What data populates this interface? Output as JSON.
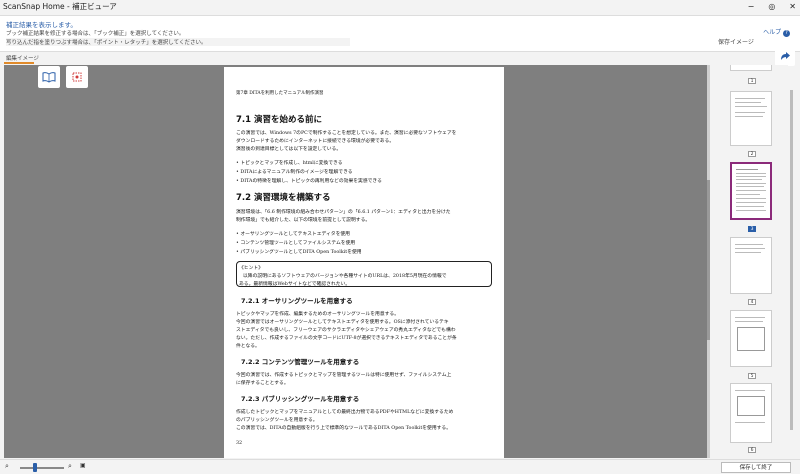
{
  "window": {
    "title": "ScanSnap Home - 補正ビューア",
    "controls": [
      "−",
      "◎",
      "✕"
    ]
  },
  "info": {
    "message": "補正結果を表示します。",
    "line1": "ブック補正結果を修正する場合は、「ブック補正」を選択してください。",
    "line2": "写り込んだ指を塗りつぶす場合は、「ポイント・レタッチ」を選択してください。",
    "help": "ヘルプ"
  },
  "sidebar": {
    "label": "保存イメージ"
  },
  "editor": {
    "label": "編集イメージ"
  },
  "page": {
    "header": "第7章 DITAを利用したマニュアル制作演習",
    "s71_title": "7.1 演習を始める前に",
    "s71_p1": "この演習では、Windows 7のPCで制作することを想定している。また、演習に必要なソフトウェアを",
    "s71_p2": "ダウンロードするためにインターネットに接続できる環境が必要である。",
    "s71_p3": "演習後の到達目標としては以下を設定している。",
    "b1": "トピックとマップを作成し、htmlに変換できる",
    "b2": "DITAによるマニュアル制作のイメージを理解できる",
    "b3": "DITAの特徴を理解し、トピックの再利用などの効果を実感できる",
    "s72_title": "7.2 演習環境を構築する",
    "s72_p1": "演習環境は、「6.6 制作環境の組み合わせパターン」の「6.6.1 パターン1：エディタと出力を分けた",
    "s72_p2": "制作環境」でも紹介した、以下の環境を前提として説明する。",
    "b4": "オーサリングツールとしてテキストエディタを使用",
    "b5": "コンテンツ管理ツールとしてファイルシステムを使用",
    "b6": "パブリッシングツールとしてDITA Open Toolkitを使用",
    "hint_title": "《ヒント》",
    "hint_p1": "以降の説明にあるソフトウェアのバージョンや各種サイトのURLは、2018年5月現在の情報で",
    "hint_p2": "ある。最新情報はWebサイトなどで確認されたい。",
    "s721_title": "7.2.1 オーサリングツールを用意する",
    "s721_p1": "トピックやマップを作成、編集するためのオーサリングツールを用意する。",
    "s721_p2": "今回の演習ではオーサリングツールとしてテキストエディタを使用する。OSに添付されているテキ",
    "s721_p3": "ストエディタでも良いし、フリーウェアのサクラエディタやシェアウェアの秀丸エディタなどでも構わ",
    "s721_p4": "ない。ただし、作成するファイルの文字コードにUTF-8が選択できるテキストエディタであることが条",
    "s721_p5": "件となる。",
    "s722_title": "7.2.2 コンテンツ管理ツールを用意する",
    "s722_p1": "今回の演習では、作成するトピックとマップを管理するツールは特に使用せず、ファイルシステム上",
    "s722_p2": "に保存することとする。",
    "s723_title": "7.2.3 パブリッシングツールを用意する",
    "s723_p1": "作成したトピックとマップをマニュアルとしての最終出力物であるPDFやHTMLなどに変換するため",
    "s723_p2": "のパブリッシングツールを用意する。",
    "s723_p3": "この演習では、DITAの自動組版を行う上で標準的なツールであるDITA Open Toolkitを使用する。",
    "page_number": "32"
  },
  "thumbnails": [
    "1",
    "2",
    "3",
    "4",
    "5",
    "6"
  ],
  "selected_thumbnail": "3",
  "footer": {
    "save_exit": "保存して終了"
  },
  "colors": {
    "accent": "#2a5ea8",
    "selection": "#8b2a7a",
    "canvas": "#7f7f7f"
  }
}
